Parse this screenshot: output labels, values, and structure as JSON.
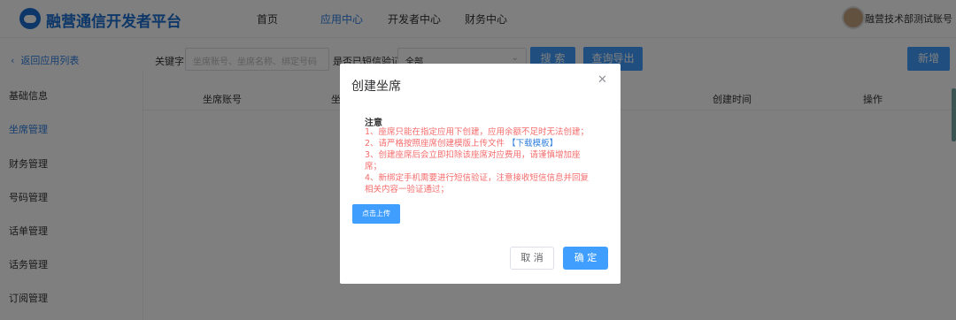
{
  "header": {
    "brand": "融营通信开发者平台",
    "nav": [
      "首页",
      "应用中心",
      "开发者中心",
      "财务中心"
    ],
    "active_nav": "应用中心",
    "user": "融营技术部测试账号"
  },
  "sidebar": {
    "back_label": "返回应用列表",
    "items": [
      {
        "label": "基础信息"
      },
      {
        "label": "坐席管理"
      },
      {
        "label": "财务管理"
      },
      {
        "label": "号码管理"
      },
      {
        "label": "话单管理"
      },
      {
        "label": "话务管理"
      },
      {
        "label": "订阅管理"
      }
    ],
    "active_item": "坐席管理"
  },
  "filter": {
    "keyword_label": "关键字",
    "keyword_placeholder": "坐席账号、坐席名称、绑定号码",
    "sms_label": "是否已短信验证",
    "sms_value": "全部",
    "search_label": "搜 索",
    "export_label": "查询导出",
    "add_label": "新增"
  },
  "table": {
    "columns": [
      "坐席账号",
      "坐",
      "创建时间",
      "操作"
    ]
  },
  "dialog": {
    "title": "创建坐席",
    "note_title": "注意",
    "notes": [
      "1、座席只能在指定应用下创建，应用余额不足时无法创建；",
      "2、请严格按照座席创建模版上传文件",
      "3、创建座席后会立即扣除该座席对应费用，请谨慎增加座",
      "席；",
      "4、新绑定手机需要进行短信验证，注意接收短信信息并回复",
      "相关内容一验证通过；"
    ],
    "template_link": "【下载模板】",
    "upload_label": "点击上传",
    "cancel_label": "取 消",
    "ok_label": "确 定"
  },
  "colors": {
    "primary": "#409eff",
    "brand": "#1a6fd1",
    "warning_text": "#f56c6c"
  }
}
